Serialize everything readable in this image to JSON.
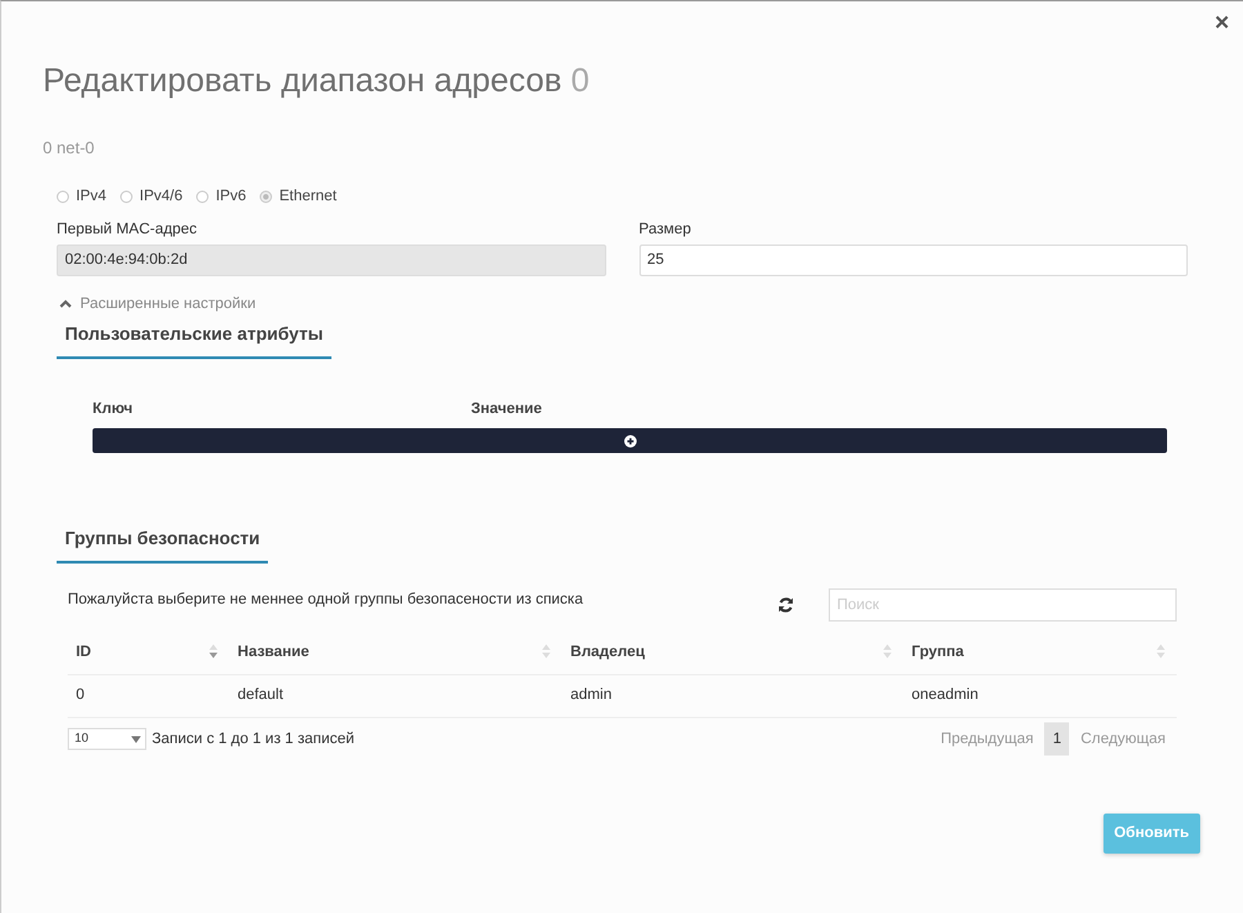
{
  "dialog": {
    "close": "×",
    "title": "Редактировать диапазон адресов",
    "title_suffix": "0",
    "subtitle": "0 net-0"
  },
  "address_types": [
    {
      "label": "IPv4",
      "selected": false
    },
    {
      "label": "IPv4/6",
      "selected": false
    },
    {
      "label": "IPv6",
      "selected": false
    },
    {
      "label": "Ethernet",
      "selected": true
    }
  ],
  "fields": [
    {
      "label": "Первый MAC-адрес",
      "value": "02:00:4e:94:0b:2d",
      "disabled": true
    },
    {
      "label": "Размер",
      "value": "25",
      "disabled": false
    }
  ],
  "advanced": {
    "label": "Расширенные настройки",
    "expanded": true
  },
  "custom_attributes": {
    "heading": "Пользовательские атрибуты",
    "columns": [
      "Ключ",
      "Значение"
    ]
  },
  "security_groups": {
    "heading": "Группы безопасности",
    "info": "Пожалуйста выберите не меннее одной группы безопасености из списка",
    "search": {
      "placeholder": "Поиск"
    },
    "columns": [
      {
        "label": "ID",
        "sorted": true
      },
      {
        "label": "Название",
        "sorted": false
      },
      {
        "label": "Владелец",
        "sorted": false
      },
      {
        "label": "Группа",
        "sorted": false
      }
    ],
    "rows": [
      [
        "0",
        "default",
        "admin",
        "oneadmin"
      ]
    ],
    "page_length": "10",
    "records_info": "Записи с 1 до 1 из 1 записей",
    "pagination": [
      {
        "label": "Предыдущая",
        "kind": "prev",
        "disabled": true,
        "selected": false
      },
      {
        "label": "1",
        "kind": "page",
        "disabled": false,
        "selected": true
      },
      {
        "label": "Следующая",
        "kind": "next",
        "disabled": true,
        "selected": false
      }
    ]
  },
  "submit": "Обновить"
}
